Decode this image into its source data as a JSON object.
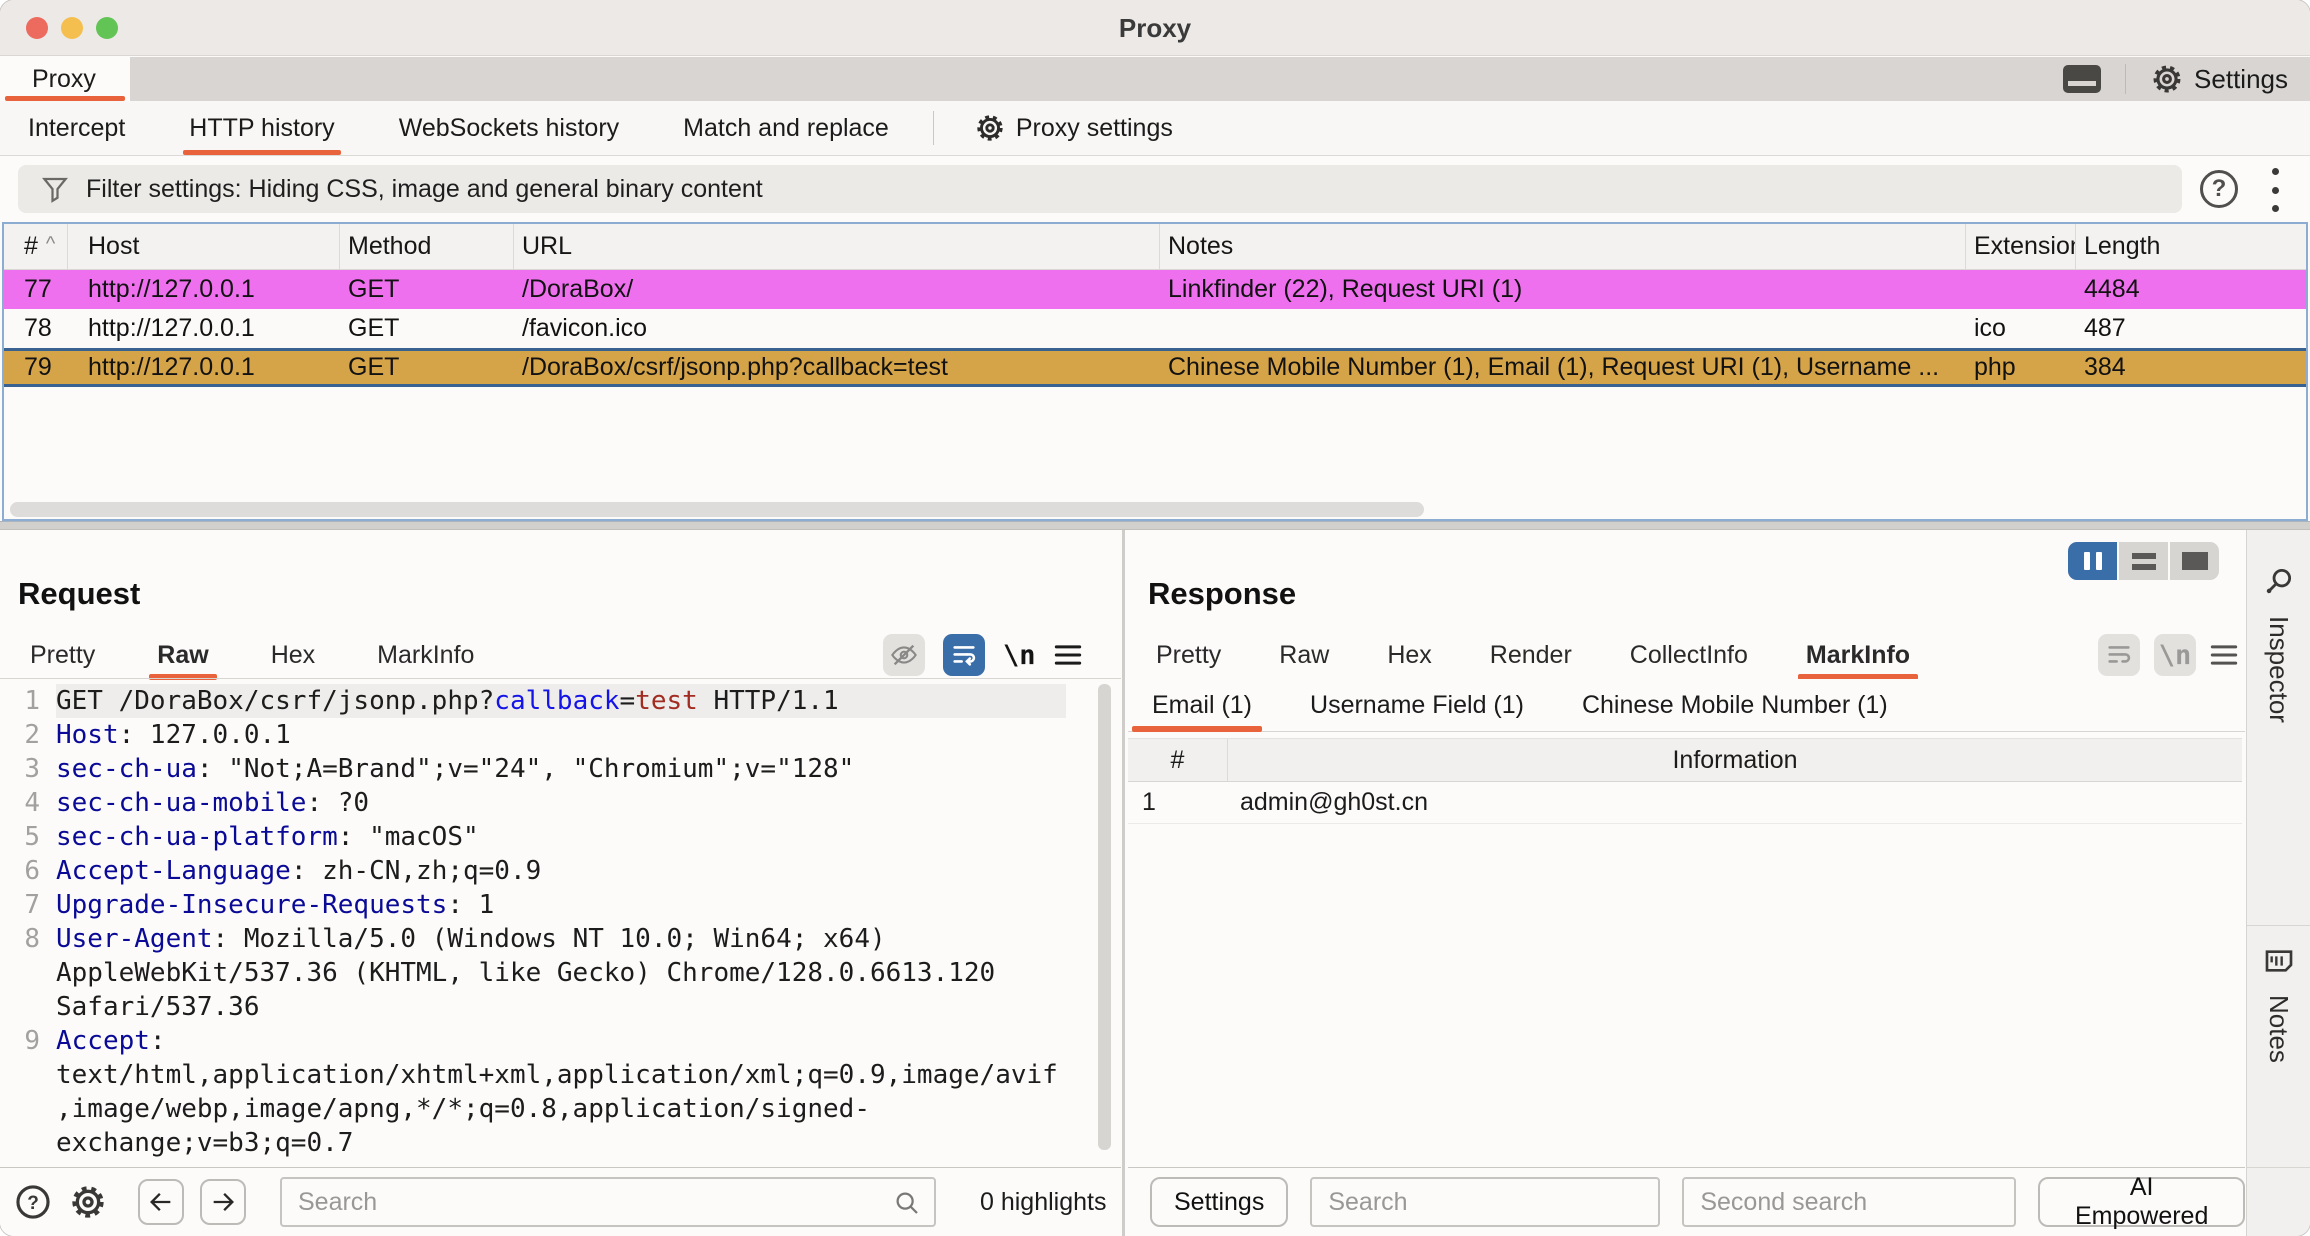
{
  "window": {
    "title": "Proxy"
  },
  "main_tabs": {
    "tab_label": "Proxy",
    "settings_label": "Settings"
  },
  "sub_tabs": {
    "items": [
      "Intercept",
      "HTTP history",
      "WebSockets history",
      "Match and replace"
    ],
    "active": "HTTP history",
    "proxy_settings_label": "Proxy settings"
  },
  "filter_bar": {
    "text": "Filter settings: Hiding CSS, image and general binary content"
  },
  "history_table": {
    "columns": [
      "#",
      "Host",
      "Method",
      "URL",
      "Notes",
      "Extension",
      "Length"
    ],
    "rows": [
      {
        "id": "77",
        "host": "http://127.0.0.1",
        "method": "GET",
        "url": "/DoraBox/",
        "notes": "Linkfinder (22), Request URI (1)",
        "extension": "",
        "length": "4484",
        "highlight": "pink",
        "selected": false
      },
      {
        "id": "78",
        "host": "http://127.0.0.1",
        "method": "GET",
        "url": "/favicon.ico",
        "notes": "",
        "extension": "ico",
        "length": "487",
        "highlight": "none",
        "selected": false
      },
      {
        "id": "79",
        "host": "http://127.0.0.1",
        "method": "GET",
        "url": "/DoraBox/csrf/jsonp.php?callback=test",
        "notes": "Chinese Mobile Number (1), Email (1), Request URI (1), Username ...",
        "extension": "php",
        "length": "384",
        "highlight": "orange",
        "selected": true
      }
    ]
  },
  "request_panel": {
    "title": "Request",
    "tabs": [
      "Pretty",
      "Raw",
      "Hex",
      "MarkInfo"
    ],
    "active_tab": "Raw",
    "newline_label": "\\n",
    "code_lines": [
      {
        "num": "1",
        "highlight": true,
        "segments": [
          {
            "text": "GET /DoraBox/csrf/jsonp.php?",
            "type": "plain"
          },
          {
            "text": "callback",
            "type": "param"
          },
          {
            "text": "=",
            "type": "plain"
          },
          {
            "text": "test",
            "type": "value"
          },
          {
            "text": " HTTP/1.1",
            "type": "plain"
          }
        ]
      },
      {
        "num": "2",
        "highlight": false,
        "segments": [
          {
            "text": "Host",
            "type": "header"
          },
          {
            "text": ": 127.0.0.1",
            "type": "plain"
          }
        ]
      },
      {
        "num": "3",
        "highlight": false,
        "segments": [
          {
            "text": "sec-ch-ua",
            "type": "header"
          },
          {
            "text": ": \"Not;A=Brand\";v=\"24\", \"Chromium\";v=\"128\"",
            "type": "plain"
          }
        ]
      },
      {
        "num": "4",
        "highlight": false,
        "segments": [
          {
            "text": "sec-ch-ua-mobile",
            "type": "header"
          },
          {
            "text": ": ?0",
            "type": "plain"
          }
        ]
      },
      {
        "num": "5",
        "highlight": false,
        "segments": [
          {
            "text": "sec-ch-ua-platform",
            "type": "header"
          },
          {
            "text": ": \"macOS\"",
            "type": "plain"
          }
        ]
      },
      {
        "num": "6",
        "highlight": false,
        "segments": [
          {
            "text": "Accept-Language",
            "type": "header"
          },
          {
            "text": ": zh-CN,zh;q=0.9",
            "type": "plain"
          }
        ]
      },
      {
        "num": "7",
        "highlight": false,
        "segments": [
          {
            "text": "Upgrade-Insecure-Requests",
            "type": "header"
          },
          {
            "text": ": 1",
            "type": "plain"
          }
        ]
      },
      {
        "num": "8",
        "highlight": false,
        "segments": [
          {
            "text": "User-Agent",
            "type": "header"
          },
          {
            "text": ": Mozilla/5.0 (Windows NT 10.0; Win64; x64) AppleWebKit/537.36 (KHTML, like Gecko) Chrome/128.0.6613.120 Safari/537.36",
            "type": "plain"
          }
        ]
      },
      {
        "num": "9",
        "highlight": false,
        "segments": [
          {
            "text": "Accept",
            "type": "header"
          },
          {
            "text": ": text/html,application/xhtml+xml,application/xml;q=0.9,image/avif,image/webp,image/apng,*/*;q=0.8,application/signed-exchange;v=b3;q=0.7",
            "type": "plain"
          }
        ]
      }
    ]
  },
  "response_panel": {
    "title": "Response",
    "tabs": [
      "Pretty",
      "Raw",
      "Hex",
      "Render",
      "CollectInfo",
      "MarkInfo"
    ],
    "active_tab": "MarkInfo",
    "newline_label": "\\n",
    "inner_tabs": [
      "Email (1)",
      "Username Field (1)",
      "Chinese Mobile Number (1)"
    ],
    "active_inner_tab": "Email (1)",
    "table": {
      "columns": [
        "#",
        "Information"
      ],
      "rows": [
        {
          "num": "1",
          "info": "admin@gh0st.cn"
        }
      ]
    }
  },
  "request_search": {
    "placeholder": "Search",
    "highlights_label": "0 highlights"
  },
  "response_toolbar": {
    "settings_label": "Settings",
    "search_placeholder": "Search",
    "second_search_placeholder": "Second search",
    "ai_label": "AI Empowered"
  },
  "sidebar": {
    "items": [
      {
        "label": "Inspector"
      },
      {
        "label": "Notes"
      }
    ]
  },
  "colors": {
    "accent_orange": "#E8633B",
    "accent_blue": "#3A6EA8",
    "row_pink": "#EF70EF",
    "row_selected_tan": "#D5A348",
    "selected_row_border": "#3A6290",
    "table_focus_border": "#8CACD2",
    "syntax_header": "#0A0A96",
    "syntax_param": "#1414E8",
    "syntax_value": "#A22C21"
  }
}
